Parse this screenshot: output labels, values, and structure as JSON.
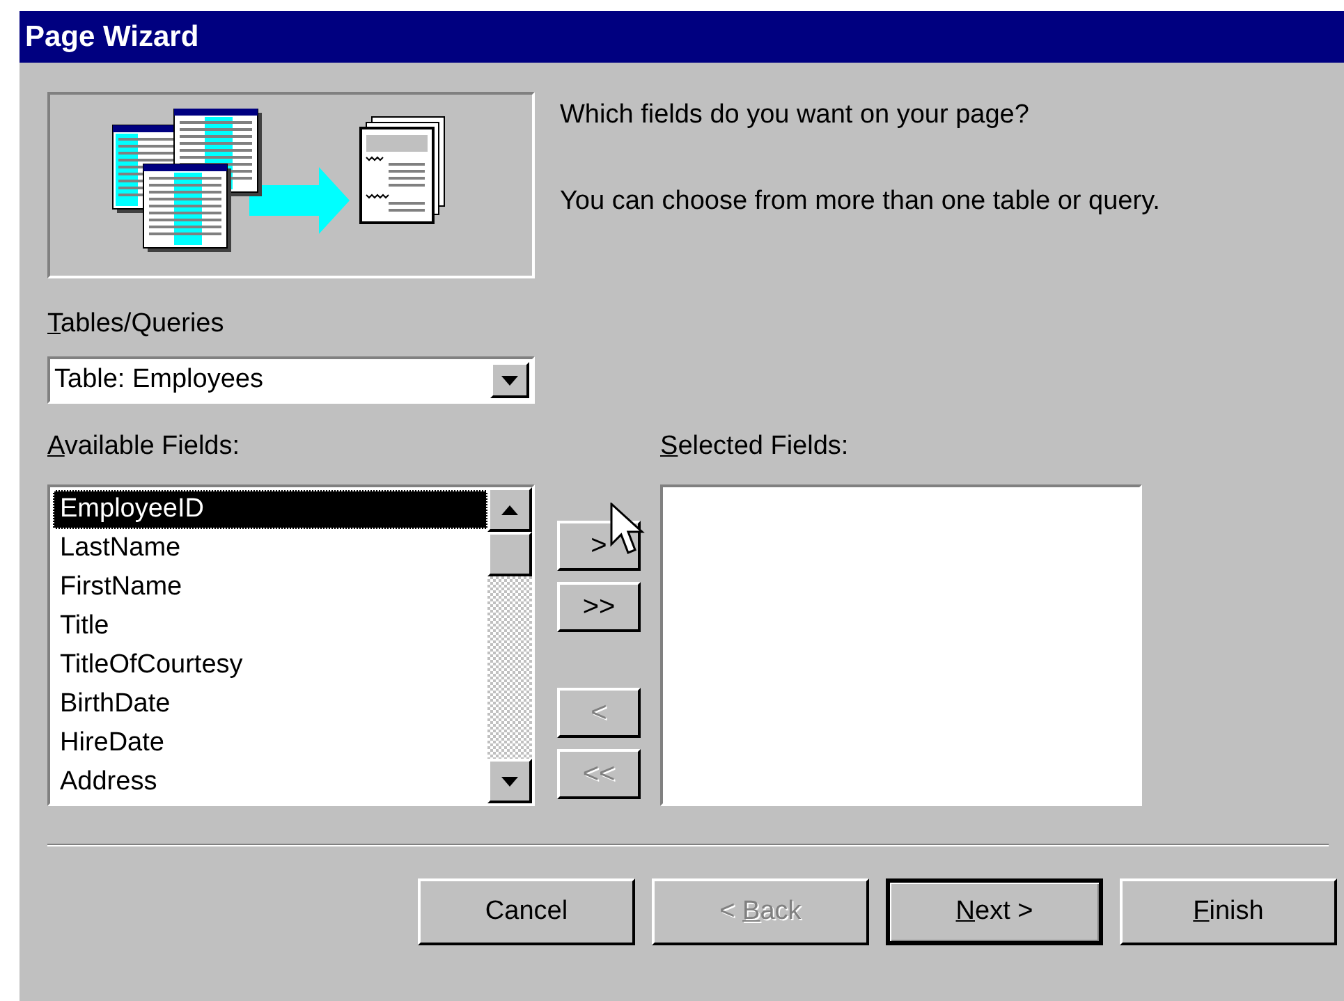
{
  "window": {
    "title": "Page Wizard"
  },
  "intro": {
    "question": "Which fields do you want on your page?",
    "hint": "You can choose from more than one table or query."
  },
  "tables_queries": {
    "label": "Tables/Queries",
    "access_key": true,
    "value": "Table: Employees"
  },
  "available_fields": {
    "label": "Available Fields:",
    "access_key": true,
    "items": [
      {
        "text": "EmployeeID",
        "selected": true
      },
      {
        "text": "LastName",
        "selected": false
      },
      {
        "text": "FirstName",
        "selected": false
      },
      {
        "text": "Title",
        "selected": false
      },
      {
        "text": "TitleOfCourtesy",
        "selected": false
      },
      {
        "text": "BirthDate",
        "selected": false
      },
      {
        "text": "HireDate",
        "selected": false
      },
      {
        "text": "Address",
        "selected": false
      }
    ]
  },
  "transfer_buttons": [
    {
      "label": ">",
      "disabled": false
    },
    {
      "label": ">>",
      "disabled": false
    },
    {
      "label": "<",
      "disabled": true
    },
    {
      "label": "<<",
      "disabled": true
    }
  ],
  "selected_fields": {
    "label": "Selected Fields:",
    "access_key": true
  },
  "buttons": [
    {
      "label": "Cancel",
      "disabled": false,
      "default": false,
      "access_key": false
    },
    {
      "label": "< Back",
      "disabled": true,
      "default": false,
      "access_key": true
    },
    {
      "label": "Next >",
      "disabled": false,
      "default": true,
      "access_key": true
    },
    {
      "label": "Finish",
      "disabled": false,
      "default": false,
      "access_key": true
    }
  ]
}
